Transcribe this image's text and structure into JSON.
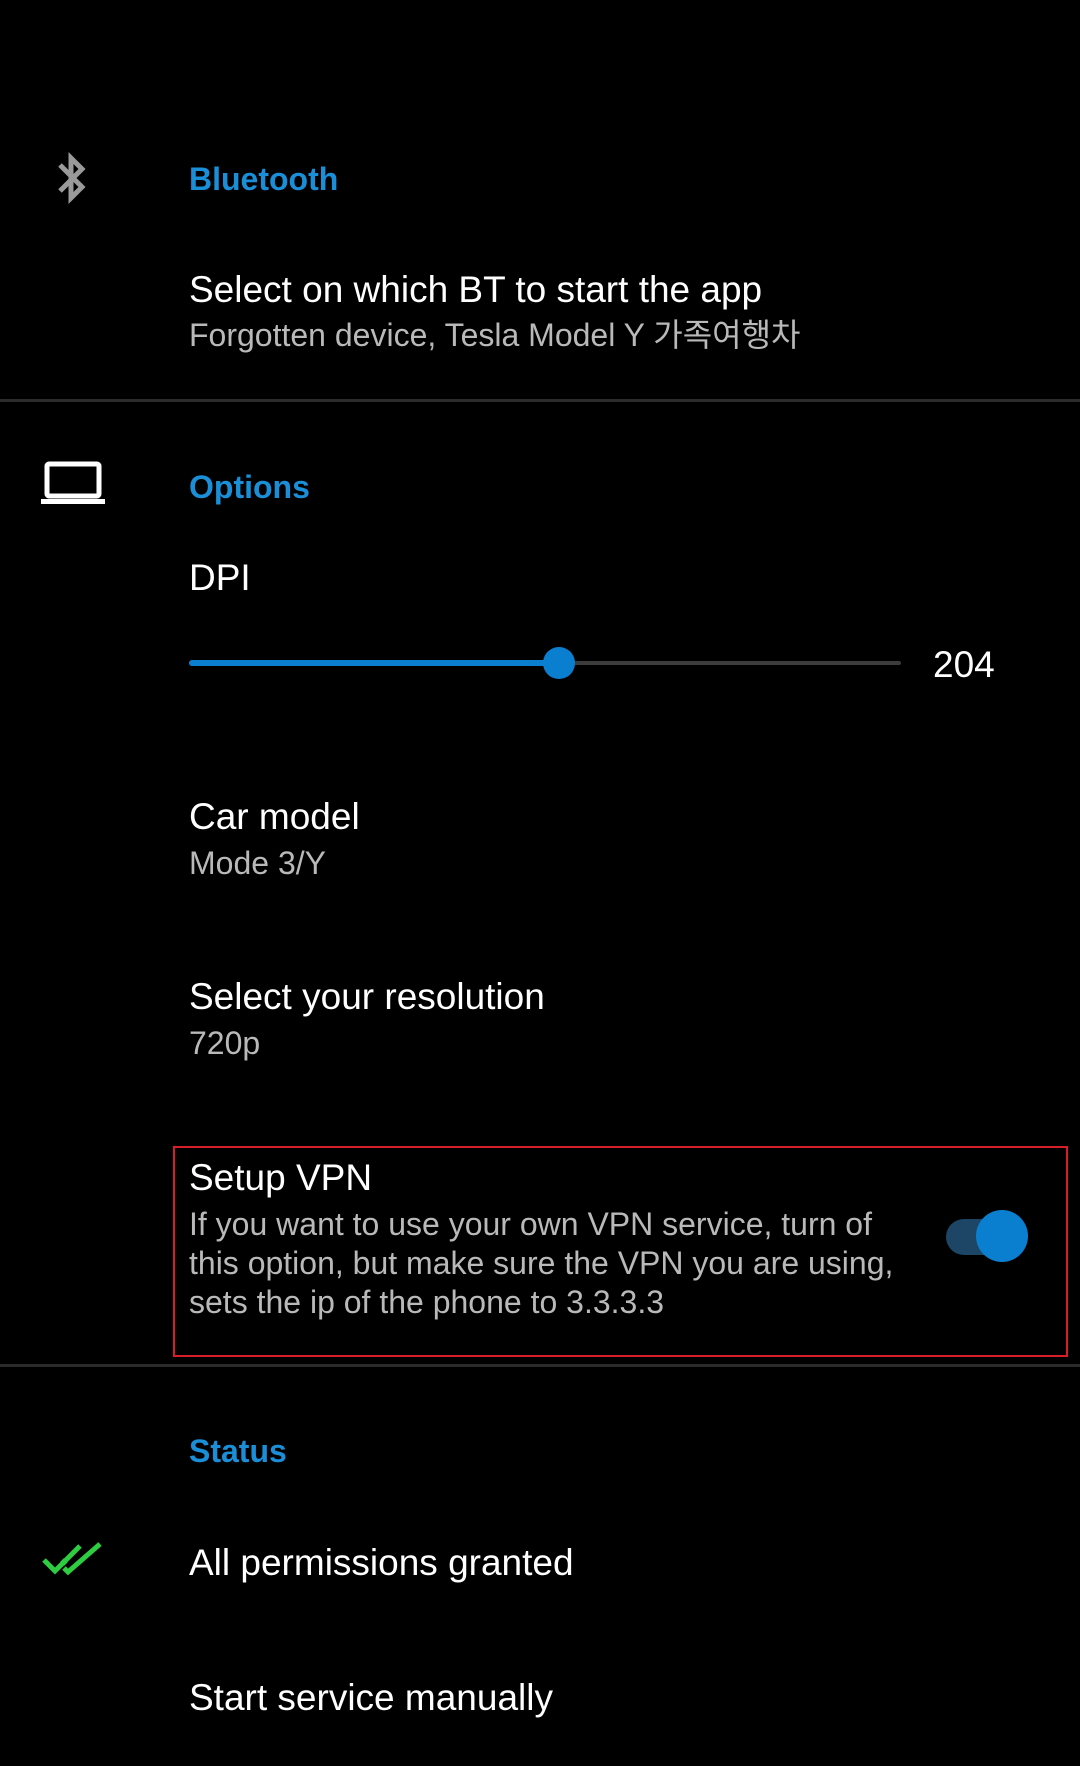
{
  "bluetooth": {
    "header": "Bluetooth",
    "icon": "bluetooth-icon",
    "select_title": "Select on which BT to start the app",
    "select_summary": "Forgotten device, Tesla Model Y 가족여행차"
  },
  "options": {
    "header": "Options",
    "icon": "laptop-icon",
    "dpi": {
      "title": "DPI",
      "value": "204",
      "fraction": 0.52
    },
    "car_model": {
      "title": "Car model",
      "summary": "Mode 3/Y"
    },
    "resolution": {
      "title": "Select your resolution",
      "summary": "720p"
    },
    "vpn": {
      "title": "Setup VPN",
      "summary": "If you want to use your own VPN service, turn of this option, but make sure the VPN you are using, sets the ip of the phone to 3.3.3.3",
      "enabled": true
    }
  },
  "status": {
    "header": "Status",
    "permissions": {
      "icon": "double-check-icon",
      "title": "All permissions granted"
    },
    "start_service": {
      "title": "Start service manually"
    }
  },
  "colors": {
    "accent": "#0a7fd0",
    "header_text": "#1a8fd8",
    "check_green": "#2ecc40",
    "highlight": "#d71c2a"
  }
}
